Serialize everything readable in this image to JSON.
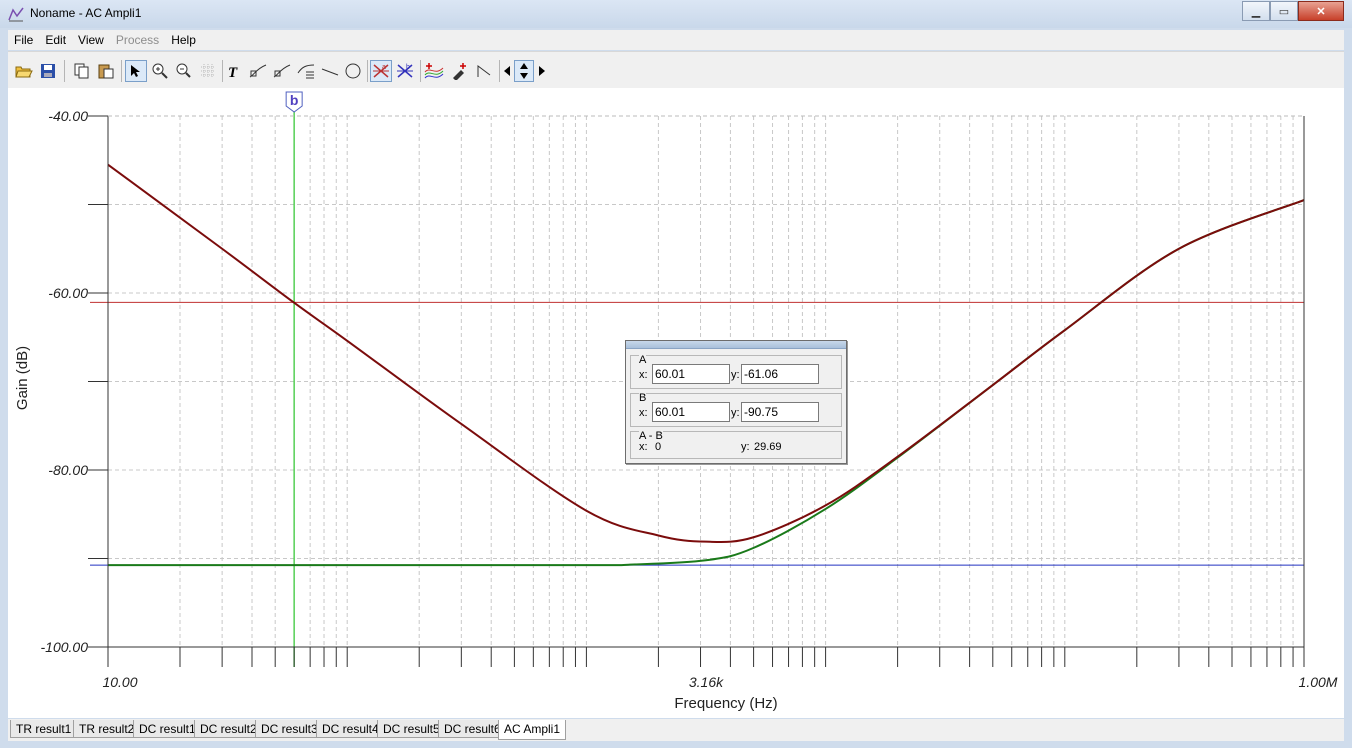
{
  "window": {
    "title": "Noname - AC Ampli1",
    "buttons": [
      "minimize",
      "maximize",
      "close"
    ]
  },
  "menu": {
    "items": [
      {
        "label": "File",
        "enabled": true
      },
      {
        "label": "Edit",
        "enabled": true
      },
      {
        "label": "View",
        "enabled": true
      },
      {
        "label": "Process",
        "enabled": false
      },
      {
        "label": "Help",
        "enabled": true
      }
    ]
  },
  "toolbar": {
    "icons": [
      "open-icon",
      "save-icon",
      "copy-icon",
      "paste-icon",
      "pointer-icon",
      "zoom-in-icon",
      "zoom-100-icon",
      "grid-icon",
      "text-icon",
      "curve-label-icon",
      "curve-label2-icon",
      "curve-label3-icon",
      "line-icon",
      "circle-icon",
      "cursor-a-icon",
      "cursor-b-icon",
      "curves-icon",
      "pick-icon",
      "step-icon",
      "arrow-left-icon",
      "arrow-updown-icon",
      "arrow-right-icon"
    ]
  },
  "chart_data": {
    "type": "line",
    "xlabel": "Frequency (Hz)",
    "ylabel": "Gain (dB)",
    "x_scale": "log",
    "xlim": [
      10,
      1000000
    ],
    "ylim": [
      -100,
      -40
    ],
    "x_tick_labels": [
      "10.00",
      "3.16k",
      "1.00M"
    ],
    "y_tick_labels": [
      "-40.00",
      "-60.00",
      "-80.00",
      "-100.00"
    ],
    "grid": true,
    "series": [
      {
        "color": "#7b0c0c",
        "x": [
          10,
          30,
          60,
          100,
          300,
          1000,
          2000,
          3160,
          5000,
          10000,
          20000,
          50000,
          100000,
          300000,
          1000000
        ],
        "y": [
          -45.5,
          -55.0,
          -61.1,
          -65.4,
          -74.8,
          -84.6,
          -87.4,
          -88.1,
          -87.6,
          -84.0,
          -78.5,
          -70.4,
          -64.2,
          -55.0,
          -49.5
        ]
      },
      {
        "color": "#1a7a1a",
        "x": [
          10,
          100,
          1000,
          1500,
          3160,
          5000,
          10000,
          20000,
          50000,
          100000,
          300000,
          1000000
        ],
        "y": [
          -90.75,
          -90.75,
          -90.75,
          -90.7,
          -90.2,
          -88.8,
          -84.4,
          -78.6,
          -70.4,
          -64.2,
          -55.0,
          -49.5
        ]
      }
    ],
    "cursor_lines": [
      {
        "name": "A",
        "axis": "y",
        "value": -61.06,
        "color": "#c03030"
      },
      {
        "name": "B",
        "axis": "y",
        "value": -90.75,
        "color": "#2030c0"
      },
      {
        "name": "b",
        "axis": "x",
        "value": 60.01,
        "color": "#55d055"
      }
    ],
    "marker_label": "b"
  },
  "readout": {
    "a": {
      "label": "A",
      "x": "60.01",
      "y": "-61.06"
    },
    "b": {
      "label": "B",
      "x": "60.01",
      "y": "-90.75"
    },
    "diff": {
      "label": "A - B",
      "x": "0",
      "y": "29.69"
    },
    "x_prefix": "x:",
    "y_prefix": "y:"
  },
  "tabs": [
    {
      "label": "TR result1",
      "active": false
    },
    {
      "label": "TR result2",
      "active": false
    },
    {
      "label": "DC result1",
      "active": false
    },
    {
      "label": "DC result2",
      "active": false
    },
    {
      "label": "DC result3",
      "active": false
    },
    {
      "label": "DC result4",
      "active": false
    },
    {
      "label": "DC result5",
      "active": false
    },
    {
      "label": "DC result6",
      "active": false
    },
    {
      "label": "AC Ampli1",
      "active": true
    }
  ]
}
